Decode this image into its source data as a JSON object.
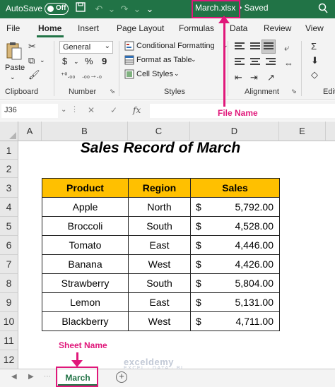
{
  "titlebar": {
    "autosave_label": "AutoSave",
    "autosave_state": "Off",
    "file_name": "March.xlsx",
    "save_status": "• Saved"
  },
  "ribbon_tabs": [
    "File",
    "Home",
    "Insert",
    "Page Layout",
    "Formulas",
    "Data",
    "Review",
    "View"
  ],
  "ribbon": {
    "clipboard": {
      "paste_label": "Paste",
      "group_label": "Clipboard"
    },
    "number": {
      "format_value": "General",
      "currency_symbol": "$",
      "percent_symbol": "%",
      "comma_symbol": "9",
      "group_label": "Number"
    },
    "styles": {
      "conditional_formatting": "Conditional Formatting",
      "format_as_table": "Format as Table",
      "cell_styles": "Cell Styles",
      "group_label": "Styles"
    },
    "alignment": {
      "group_label": "Alignment"
    },
    "editing": {
      "group_label": "Editi"
    }
  },
  "formula_bar": {
    "name_box": "J36",
    "cancel_symbol": "✕",
    "enter_symbol": "✓",
    "fx_label": "fx",
    "formula_value": ""
  },
  "annotations": {
    "file_name_label": "File Name",
    "sheet_name_label": "Sheet Name"
  },
  "columns": [
    "A",
    "B",
    "C",
    "D",
    "E"
  ],
  "rows": [
    "1",
    "2",
    "3",
    "4",
    "5",
    "6",
    "7",
    "8",
    "9",
    "10",
    "11",
    "12"
  ],
  "sheet": {
    "title": "Sales Record of March",
    "headers": {
      "product": "Product",
      "region": "Region",
      "sales": "Sales"
    },
    "currency": "$",
    "records": [
      {
        "product": "Apple",
        "region": "North",
        "sales": "5,792.00"
      },
      {
        "product": "Broccoli",
        "region": "South",
        "sales": "4,528.00"
      },
      {
        "product": "Tomato",
        "region": "East",
        "sales": "4,446.00"
      },
      {
        "product": "Banana",
        "region": "West",
        "sales": "4,426.00"
      },
      {
        "product": "Strawberry",
        "region": "South",
        "sales": "5,804.00"
      },
      {
        "product": "Lemon",
        "region": "East",
        "sales": "5,131.00"
      },
      {
        "product": "Blackberry",
        "region": "West",
        "sales": "4,711.00"
      }
    ]
  },
  "sheet_tabs": {
    "active": "March",
    "add_symbol": "+"
  },
  "watermark": {
    "brand": "exceldemy",
    "tagline": "EXCEL · DATA · BI"
  },
  "colors": {
    "excel_green": "#217346",
    "header_fill": "#ffc000",
    "annotation": "#e0177a"
  }
}
